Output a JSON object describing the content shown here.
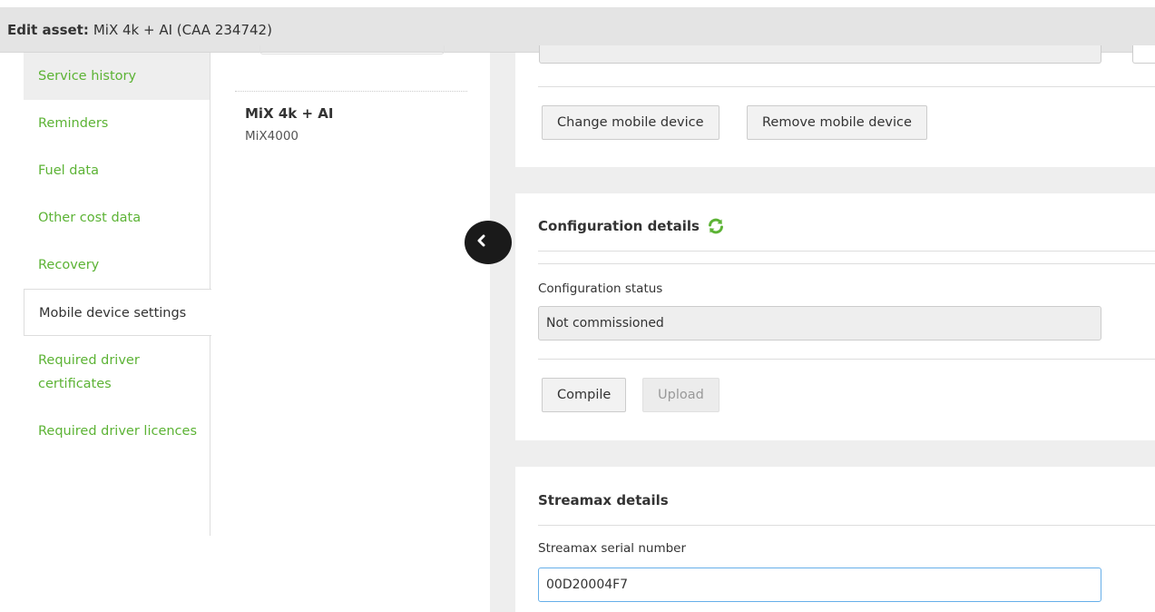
{
  "header": {
    "label": "Edit asset:",
    "asset": "MiX 4k + AI (CAA 234742)"
  },
  "sidebar": {
    "items": [
      {
        "label": "Service history"
      },
      {
        "label": "Reminders"
      },
      {
        "label": "Fuel data"
      },
      {
        "label": "Other cost data"
      },
      {
        "label": "Recovery"
      },
      {
        "label": "Mobile device settings"
      },
      {
        "label": "Required driver certificates"
      },
      {
        "label": "Required driver licences"
      }
    ]
  },
  "list": {
    "asset_name": "MiX 4k + AI",
    "asset_model": "MiX4000"
  },
  "mobile_device": {
    "change_label": "Change mobile device",
    "remove_label": "Remove mobile device"
  },
  "configuration": {
    "title": "Configuration details",
    "status_label": "Configuration status",
    "status_value": "Not commissioned",
    "compile_label": "Compile",
    "upload_label": "Upload"
  },
  "streamax": {
    "title": "Streamax details",
    "serial_label": "Streamax serial number",
    "serial_value": "00D20004F7"
  },
  "colors": {
    "accent_green": "#5cb335",
    "header_bg": "#e4e4e4",
    "focus_border": "#66afe9"
  },
  "icons": {
    "collapse": "chevron-left-icon",
    "refresh": "refresh-icon"
  }
}
